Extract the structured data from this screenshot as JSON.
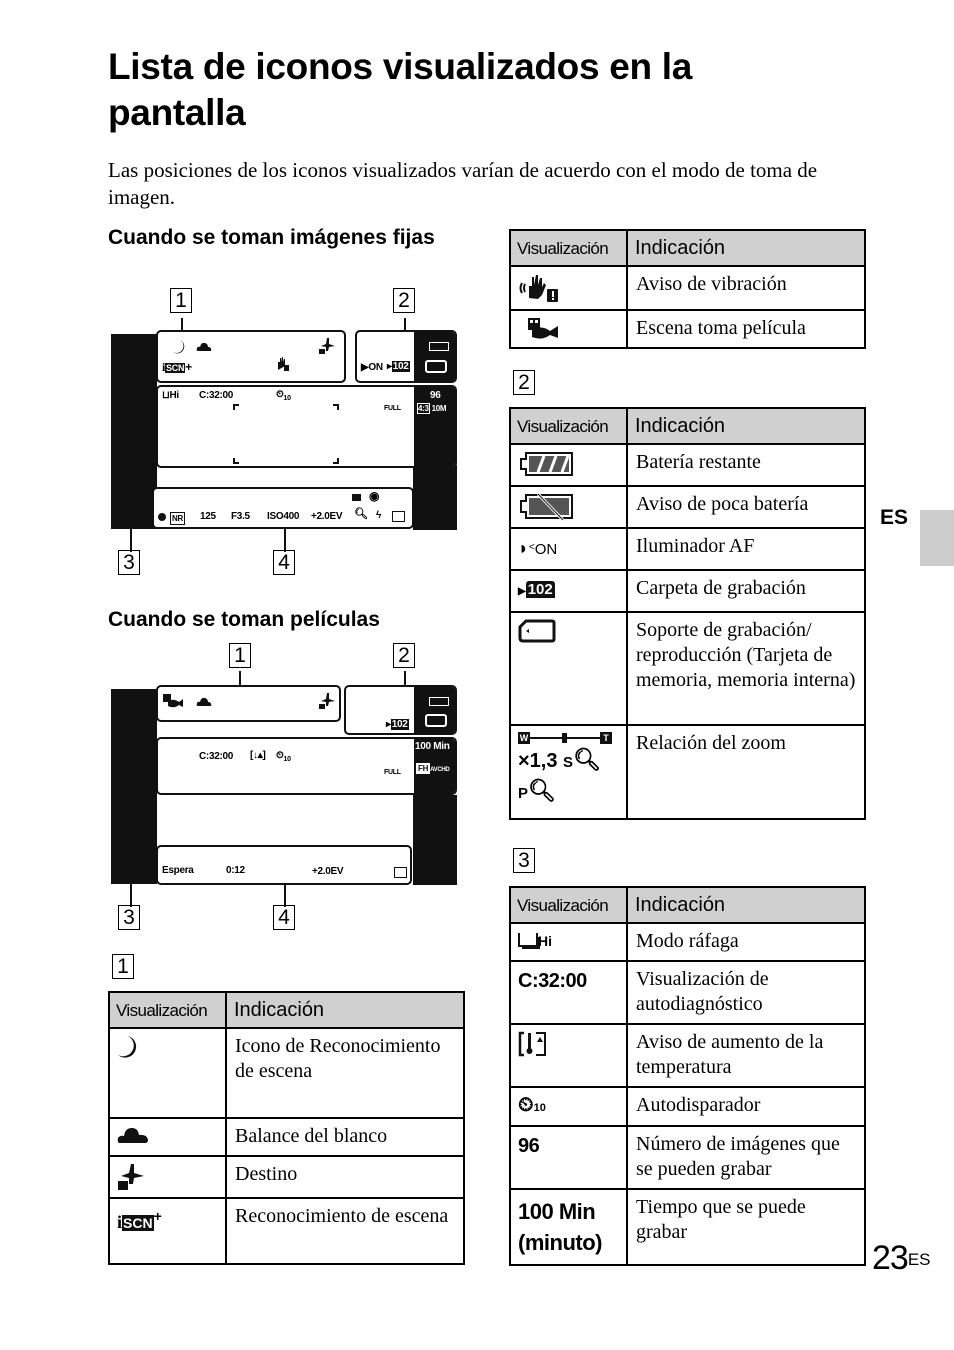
{
  "page": {
    "title": "Lista de iconos visualizados en la pantalla",
    "intro": "Las posiciones de los iconos visualizados varían de acuerdo con el modo de toma de imagen.",
    "language_tab": "ES",
    "page_number": "23",
    "page_suffix": "ES",
    "accent_gray": "#cccccc"
  },
  "still": {
    "heading": "Cuando se toman imágenes fijas",
    "callouts": [
      "1",
      "2",
      "3",
      "4"
    ],
    "screen": {
      "area3_text": "C:32:00",
      "burst": "Hi",
      "remaining_images": "96",
      "aspect": "4:3",
      "image_size": "10M",
      "quality": "FULL",
      "af_on": "ON",
      "folder": "102",
      "shutter": "125",
      "aperture": "F3.5",
      "iso": "ISO400",
      "ev": "+2.0EV",
      "nr": "NR"
    }
  },
  "movie": {
    "heading": "Cuando se toman películas",
    "callouts": [
      "1",
      "2",
      "3",
      "4"
    ],
    "screen": {
      "area3_text": "C:32:00",
      "remaining_time": "100 Min",
      "format_fh": "FH",
      "format_avchd": "AVCHD",
      "quality": "FULL",
      "folder": "102",
      "status": "Espera",
      "time": "0:12",
      "ev": "+2.0EV"
    }
  },
  "tables": {
    "col_visualizacion": "Visualización",
    "col_indicacion": "Indicación",
    "section1": {
      "label": "1",
      "rows": [
        {
          "icon": "moon-scene-icon",
          "indicacion": "Icono de Reconocimiento de escena"
        },
        {
          "icon": "cloudy-white-balance-icon",
          "indicacion": "Balance del blanco"
        },
        {
          "icon": "destination-plane-icon",
          "indicacion": "Destino"
        },
        {
          "icon": "iscn-plus-icon",
          "indicacion": "Reconocimiento de escena"
        }
      ],
      "rows_cont": [
        {
          "icon": "shake-warning-icon",
          "indicacion": "Aviso de vibración"
        },
        {
          "icon": "movie-scene-icon",
          "indicacion": "Escena toma película"
        }
      ]
    },
    "section2": {
      "label": "2",
      "rows": [
        {
          "icon": "battery-remaining-icon",
          "indicacion": "Batería restante"
        },
        {
          "icon": "low-battery-icon",
          "indicacion": "Aviso de poca batería"
        },
        {
          "icon": "af-illuminator-icon",
          "icon_text": "ON",
          "indicacion": "Iluminador AF"
        },
        {
          "icon": "recording-folder-icon",
          "icon_text": "102",
          "indicacion": "Carpeta de grabación"
        },
        {
          "icon": "memory-card-icon",
          "indicacion": "Soporte de grabación/ reproducción (Tarjeta de memoria, memoria interna)"
        },
        {
          "icon": "zoom-ratio-icon",
          "icon_text": "×1,3",
          "icon_text2": "S",
          "icon_text3": "P",
          "zoom_w": "W",
          "zoom_t": "T",
          "indicacion": "Relación del zoom"
        }
      ]
    },
    "section3": {
      "label": "3",
      "rows": [
        {
          "icon": "burst-mode-icon",
          "icon_text": "Hi",
          "indicacion": "Modo ráfaga"
        },
        {
          "icon": "text",
          "icon_text": "C:32:00",
          "indicacion": "Visualización de autodiagnóstico"
        },
        {
          "icon": "temperature-warning-icon",
          "indicacion": "Aviso de aumento de la temperatura"
        },
        {
          "icon": "self-timer-icon",
          "icon_text": "10",
          "indicacion": "Autodisparador"
        },
        {
          "icon": "text",
          "icon_text": "96",
          "indicacion": "Número de imágenes que se pueden grabar"
        },
        {
          "icon": "text",
          "icon_text": "100 Min (minuto)",
          "indicacion": "Tiempo que se puede grabar"
        }
      ]
    }
  }
}
